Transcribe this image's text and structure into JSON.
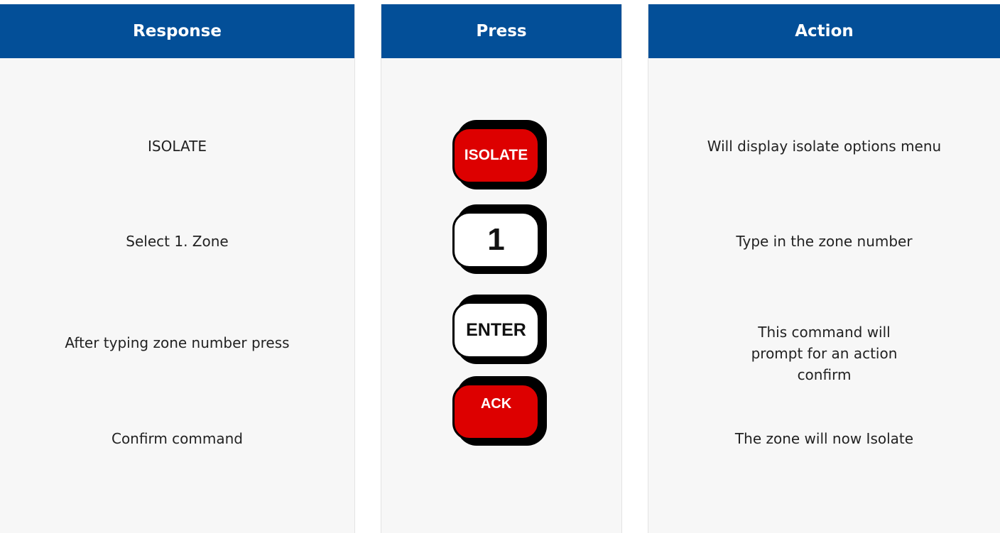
{
  "headers": {
    "response": "Response",
    "press": "Press",
    "action": "Action"
  },
  "rows": [
    {
      "response": "ISOLATE",
      "key": "ISOLATE",
      "action": "Will display isolate options menu"
    },
    {
      "response": "Select 1. Zone",
      "key": "1",
      "action": "Type in the zone number"
    },
    {
      "response": "After typing zone number press",
      "key": "ENTER",
      "action": "This command will prompt for an action confirm"
    },
    {
      "response": "Confirm command",
      "key": "ACK",
      "action": "The zone will now Isolate"
    }
  ],
  "colors": {
    "header": "#034f98",
    "panel": "#f7f7f7",
    "key_red": "#dd0000",
    "key_white": "#ffffff"
  }
}
